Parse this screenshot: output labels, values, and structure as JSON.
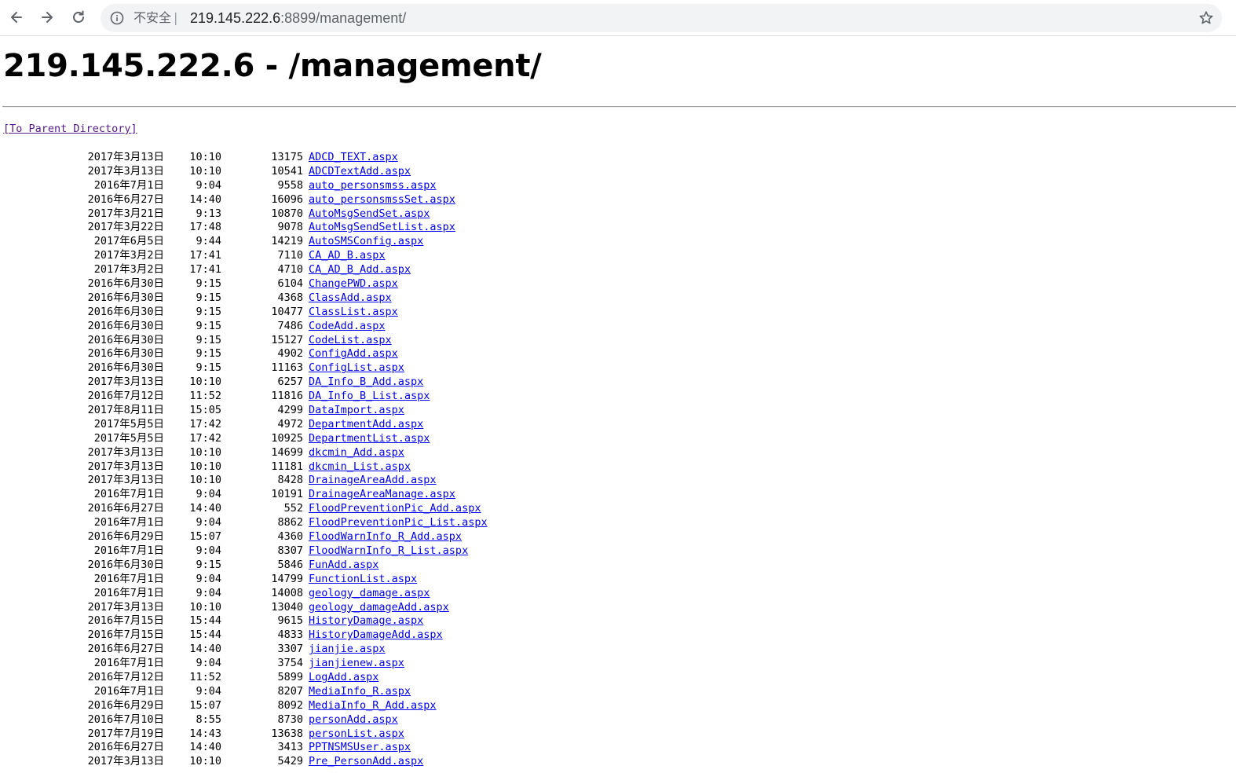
{
  "browser": {
    "security_label": "不安全",
    "separator": "|",
    "url_host": "219.145.222.6",
    "url_rest": ":8899/management/"
  },
  "page": {
    "heading": "219.145.222.6 - /management/",
    "parent_link": "[To Parent Directory]"
  },
  "files": [
    {
      "date": "2017年3月13日",
      "time": "10:10",
      "size": "13175",
      "name": "ADCD_TEXT.aspx"
    },
    {
      "date": "2017年3月13日",
      "time": "10:10",
      "size": "10541",
      "name": "ADCDTextAdd.aspx"
    },
    {
      "date": "2016年7月1日",
      "time": "9:04",
      "size": "9558",
      "name": "auto_personsmss.aspx"
    },
    {
      "date": "2016年6月27日",
      "time": "14:40",
      "size": "16096",
      "name": "auto_personsmssSet.aspx"
    },
    {
      "date": "2017年3月21日",
      "time": "9:13",
      "size": "10870",
      "name": "AutoMsgSendSet.aspx"
    },
    {
      "date": "2017年3月22日",
      "time": "17:48",
      "size": "9078",
      "name": "AutoMsgSendSetList.aspx"
    },
    {
      "date": "2017年6月5日",
      "time": "9:44",
      "size": "14219",
      "name": "AutoSMSConfig.aspx"
    },
    {
      "date": "2017年3月2日",
      "time": "17:41",
      "size": "7110",
      "name": "CA_AD_B.aspx"
    },
    {
      "date": "2017年3月2日",
      "time": "17:41",
      "size": "4710",
      "name": "CA_AD_B_Add.aspx"
    },
    {
      "date": "2016年6月30日",
      "time": "9:15",
      "size": "6104",
      "name": "ChangePWD.aspx"
    },
    {
      "date": "2016年6月30日",
      "time": "9:15",
      "size": "4368",
      "name": "ClassAdd.aspx"
    },
    {
      "date": "2016年6月30日",
      "time": "9:15",
      "size": "10477",
      "name": "ClassList.aspx"
    },
    {
      "date": "2016年6月30日",
      "time": "9:15",
      "size": "7486",
      "name": "CodeAdd.aspx"
    },
    {
      "date": "2016年6月30日",
      "time": "9:15",
      "size": "15127",
      "name": "CodeList.aspx"
    },
    {
      "date": "2016年6月30日",
      "time": "9:15",
      "size": "4902",
      "name": "ConfigAdd.aspx"
    },
    {
      "date": "2016年6月30日",
      "time": "9:15",
      "size": "11163",
      "name": "ConfigList.aspx"
    },
    {
      "date": "2017年3月13日",
      "time": "10:10",
      "size": "6257",
      "name": "DA_Info_B_Add.aspx"
    },
    {
      "date": "2016年7月12日",
      "time": "11:52",
      "size": "11816",
      "name": "DA_Info_B_List.aspx"
    },
    {
      "date": "2017年8月11日",
      "time": "15:05",
      "size": "4299",
      "name": "DataImport.aspx"
    },
    {
      "date": "2017年5月5日",
      "time": "17:42",
      "size": "4972",
      "name": "DepartmentAdd.aspx"
    },
    {
      "date": "2017年5月5日",
      "time": "17:42",
      "size": "10925",
      "name": "DepartmentList.aspx"
    },
    {
      "date": "2017年3月13日",
      "time": "10:10",
      "size": "14699",
      "name": "dkcmin_Add.aspx"
    },
    {
      "date": "2017年3月13日",
      "time": "10:10",
      "size": "11181",
      "name": "dkcmin_List.aspx"
    },
    {
      "date": "2017年3月13日",
      "time": "10:10",
      "size": "8428",
      "name": "DrainageAreaAdd.aspx"
    },
    {
      "date": "2016年7月1日",
      "time": "9:04",
      "size": "10191",
      "name": "DrainageAreaManage.aspx"
    },
    {
      "date": "2016年6月27日",
      "time": "14:40",
      "size": "552",
      "name": "FloodPreventionPic_Add.aspx"
    },
    {
      "date": "2016年7月1日",
      "time": "9:04",
      "size": "8862",
      "name": "FloodPreventionPic_List.aspx"
    },
    {
      "date": "2016年6月29日",
      "time": "15:07",
      "size": "4360",
      "name": "FloodWarnInfo_R_Add.aspx"
    },
    {
      "date": "2016年7月1日",
      "time": "9:04",
      "size": "8307",
      "name": "FloodWarnInfo_R_List.aspx"
    },
    {
      "date": "2016年6月30日",
      "time": "9:15",
      "size": "5846",
      "name": "FunAdd.aspx"
    },
    {
      "date": "2016年7月1日",
      "time": "9:04",
      "size": "14799",
      "name": "FunctionList.aspx"
    },
    {
      "date": "2016年7月1日",
      "time": "9:04",
      "size": "14008",
      "name": "geology_damage.aspx"
    },
    {
      "date": "2017年3月13日",
      "time": "10:10",
      "size": "13040",
      "name": "geology_damageAdd.aspx"
    },
    {
      "date": "2016年7月15日",
      "time": "15:44",
      "size": "9615",
      "name": "HistoryDamage.aspx"
    },
    {
      "date": "2016年7月15日",
      "time": "15:44",
      "size": "4833",
      "name": "HistoryDamageAdd.aspx"
    },
    {
      "date": "2016年6月27日",
      "time": "14:40",
      "size": "3307",
      "name": "jianjie.aspx"
    },
    {
      "date": "2016年7月1日",
      "time": "9:04",
      "size": "3754",
      "name": "jianjienew.aspx"
    },
    {
      "date": "2016年7月12日",
      "time": "11:52",
      "size": "5899",
      "name": "LogAdd.aspx"
    },
    {
      "date": "2016年7月1日",
      "time": "9:04",
      "size": "8207",
      "name": "MediaInfo_R.aspx"
    },
    {
      "date": "2016年6月29日",
      "time": "15:07",
      "size": "8092",
      "name": "MediaInfo_R_Add.aspx"
    },
    {
      "date": "2016年7月10日",
      "time": "8:55",
      "size": "8730",
      "name": "personAdd.aspx"
    },
    {
      "date": "2017年7月19日",
      "time": "14:43",
      "size": "13638",
      "name": "personList.aspx"
    },
    {
      "date": "2016年6月27日",
      "time": "14:40",
      "size": "3413",
      "name": "PPTNSMSUser.aspx"
    },
    {
      "date": "2017年3月13日",
      "time": "10:10",
      "size": "5429",
      "name": "Pre_PersonAdd.aspx"
    }
  ]
}
